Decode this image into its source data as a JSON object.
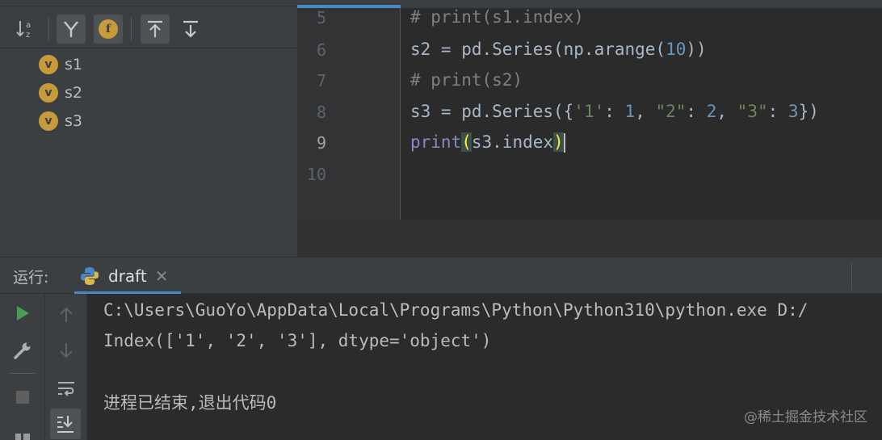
{
  "structure": {
    "toolbar": [
      {
        "name": "sort-alpha-icon"
      },
      {
        "name": "show-fields-icon"
      },
      {
        "name": "show-functions-icon"
      },
      {
        "name": "expand-all-icon"
      },
      {
        "name": "collapse-all-icon"
      }
    ],
    "items": [
      {
        "badge": "v",
        "label": "s1"
      },
      {
        "badge": "v",
        "label": "s2"
      },
      {
        "badge": "v",
        "label": "s3"
      }
    ],
    "function_badge": "f"
  },
  "editor": {
    "line_numbers": [
      "5",
      "6",
      "7",
      "8",
      "9",
      "10"
    ],
    "current_line": "9",
    "lines": {
      "l5": "# print(s1.index)",
      "l6_a": "s2 = pd.Series(np.arange(",
      "l6_num": "10",
      "l6_b": "))",
      "l7": "# print(s2)",
      "l8_a": "s3 = pd.Series({",
      "l8_s1": "'1'",
      "l8_c1": ": ",
      "l8_n1": "1",
      "l8_c2": ", ",
      "l8_s2": "\"2\"",
      "l8_c3": ": ",
      "l8_n2": "2",
      "l8_c4": ", ",
      "l8_s3": "\"3\"",
      "l8_c5": ": ",
      "l8_n3": "3",
      "l8_b": "})",
      "l9_kw": "print",
      "l9_open": "(",
      "l9_mid": "s3.index",
      "l9_close": ")"
    }
  },
  "run": {
    "label": "运行:",
    "tab_name": "draft",
    "tab_close": "✕",
    "console": [
      "C:\\Users\\GuoYo\\AppData\\Local\\Programs\\Python\\Python310\\python.exe D:/",
      "Index(['1', '2', '3'], dtype='object')",
      "",
      "进程已结束,退出代码0"
    ]
  },
  "watermark": "@稀土掘金技术社区",
  "colors": {
    "run_green": "#499c54",
    "badge": "#c79a3a",
    "accent": "#4a88c7"
  }
}
